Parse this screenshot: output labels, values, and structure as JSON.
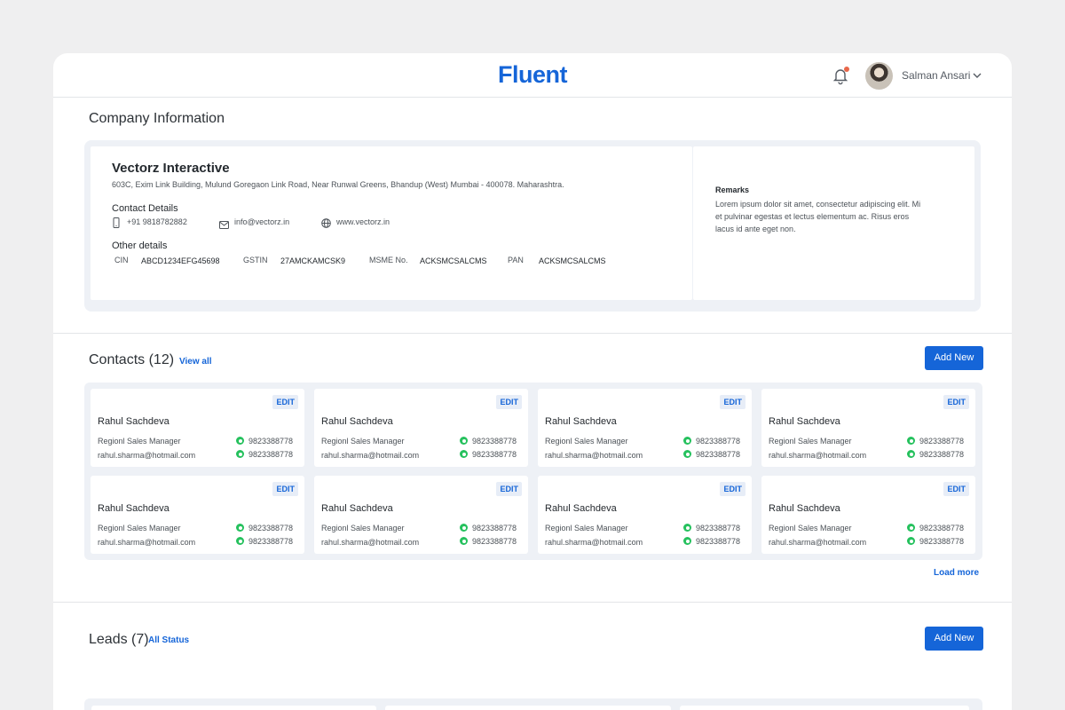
{
  "header": {
    "logo": "Fluent",
    "user_name": "Salman Ansari"
  },
  "company_section": {
    "title": "Company Information",
    "name": "Vectorz Interactive",
    "address": "603C, Exim Link Building, Mulund Goregaon Link Road, Near Runwal Greens, Bhandup (West) Mumbai - 400078.  Maharashtra.",
    "contact_details_label": "Contact Details",
    "phone": "+91 9818782882",
    "email": "info@vectorz.in",
    "website": "www.vectorz.in",
    "other_details_label": "Other details",
    "other_details": [
      {
        "label": "CIN",
        "value": "ABCD1234EFG45698"
      },
      {
        "label": "GSTIN",
        "value": "27AMCKAMCSK9"
      },
      {
        "label": "MSME No.",
        "value": "ACKSMCSALCMS"
      },
      {
        "label": "PAN",
        "value": "ACKSMCSALCMS"
      }
    ],
    "remarks_label": "Remarks",
    "remarks_text": "Lorem ipsum dolor sit amet, consectetur adipiscing elit. Mi et pulvinar egestas et lectus elementum ac. Risus eros lacus id ante eget non."
  },
  "contacts_section": {
    "title": "Contacts (12)",
    "view_all": "View all",
    "add_new": "Add New",
    "load_more": "Load more",
    "edit_label": "EDIT",
    "contacts": [
      {
        "name": "Rahul Sachdeva",
        "role": "Regionl Sales Manager",
        "email": "rahul.sharma@hotmail.com",
        "phone1": "9823388778",
        "phone2": "9823388778"
      },
      {
        "name": "Rahul Sachdeva",
        "role": "Regionl Sales Manager",
        "email": "rahul.sharma@hotmail.com",
        "phone1": "9823388778",
        "phone2": "9823388778"
      },
      {
        "name": "Rahul Sachdeva",
        "role": "Regionl Sales Manager",
        "email": "rahul.sharma@hotmail.com",
        "phone1": "9823388778",
        "phone2": "9823388778"
      },
      {
        "name": "Rahul Sachdeva",
        "role": "Regionl Sales Manager",
        "email": "rahul.sharma@hotmail.com",
        "phone1": "9823388778",
        "phone2": "9823388778"
      },
      {
        "name": "Rahul Sachdeva",
        "role": "Regionl Sales Manager",
        "email": "rahul.sharma@hotmail.com",
        "phone1": "9823388778",
        "phone2": "9823388778"
      },
      {
        "name": "Rahul Sachdeva",
        "role": "Regionl Sales Manager",
        "email": "rahul.sharma@hotmail.com",
        "phone1": "9823388778",
        "phone2": "9823388778"
      },
      {
        "name": "Rahul Sachdeva",
        "role": "Regionl Sales Manager",
        "email": "rahul.sharma@hotmail.com",
        "phone1": "9823388778",
        "phone2": "9823388778"
      },
      {
        "name": "Rahul Sachdeva",
        "role": "Regionl Sales Manager",
        "email": "rahul.sharma@hotmail.com",
        "phone1": "9823388778",
        "phone2": "9823388778"
      }
    ]
  },
  "leads_section": {
    "title": "Leads",
    "count": "(7)",
    "all_status": "All Status",
    "add_new": "Add New"
  },
  "colors": {
    "accent": "#1565d8",
    "whatsapp": "#25c15d",
    "notification_dot": "#e8674a"
  }
}
